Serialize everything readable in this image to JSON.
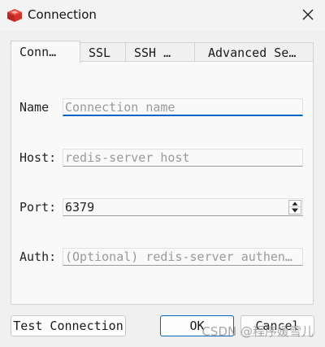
{
  "window": {
    "title": "Connection",
    "icon": "redis-cube-icon",
    "close_icon": "close-icon",
    "accent_color": "#0067c0"
  },
  "tabs": [
    {
      "label": "Conn…",
      "active": true
    },
    {
      "label": "SSL",
      "active": false
    },
    {
      "label": "SSH …",
      "active": false
    },
    {
      "label": "Advanced Se…",
      "active": false
    }
  ],
  "form": {
    "name_label": "Name",
    "name_placeholder": "Connection name",
    "name_value": "",
    "host_label": "Host:",
    "host_placeholder": "redis-server host",
    "host_value": "",
    "port_label": "Port:",
    "port_value": "6379",
    "auth_label": "Auth:",
    "auth_placeholder": "(Optional) redis-server authen…",
    "auth_value": ""
  },
  "buttons": {
    "test": "Test Connection",
    "ok": "OK",
    "cancel": "Cancel"
  },
  "watermark": "CSDN @程序媛雪儿"
}
